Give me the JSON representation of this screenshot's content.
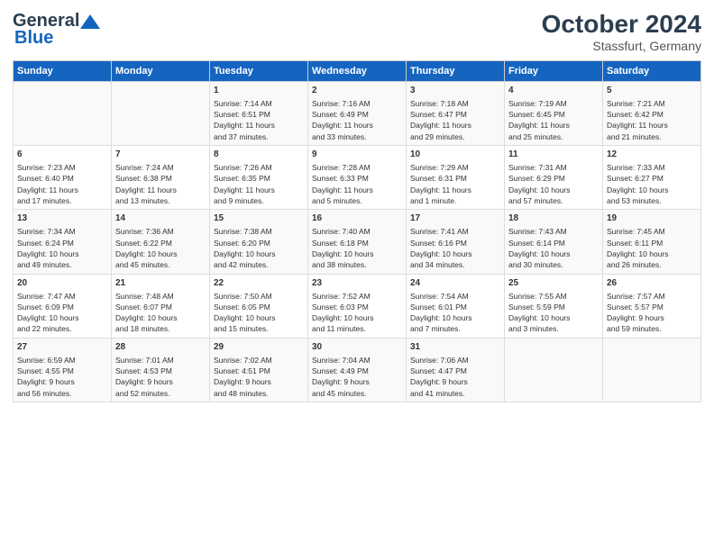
{
  "header": {
    "logo_general": "General",
    "logo_blue": "Blue",
    "title": "October 2024",
    "subtitle": "Stassfurt, Germany"
  },
  "columns": [
    "Sunday",
    "Monday",
    "Tuesday",
    "Wednesday",
    "Thursday",
    "Friday",
    "Saturday"
  ],
  "weeks": [
    [
      {
        "day": "",
        "content": ""
      },
      {
        "day": "",
        "content": ""
      },
      {
        "day": "1",
        "content": "Sunrise: 7:14 AM\nSunset: 6:51 PM\nDaylight: 11 hours\nand 37 minutes."
      },
      {
        "day": "2",
        "content": "Sunrise: 7:16 AM\nSunset: 6:49 PM\nDaylight: 11 hours\nand 33 minutes."
      },
      {
        "day": "3",
        "content": "Sunrise: 7:18 AM\nSunset: 6:47 PM\nDaylight: 11 hours\nand 29 minutes."
      },
      {
        "day": "4",
        "content": "Sunrise: 7:19 AM\nSunset: 6:45 PM\nDaylight: 11 hours\nand 25 minutes."
      },
      {
        "day": "5",
        "content": "Sunrise: 7:21 AM\nSunset: 6:42 PM\nDaylight: 11 hours\nand 21 minutes."
      }
    ],
    [
      {
        "day": "6",
        "content": "Sunrise: 7:23 AM\nSunset: 6:40 PM\nDaylight: 11 hours\nand 17 minutes."
      },
      {
        "day": "7",
        "content": "Sunrise: 7:24 AM\nSunset: 6:38 PM\nDaylight: 11 hours\nand 13 minutes."
      },
      {
        "day": "8",
        "content": "Sunrise: 7:26 AM\nSunset: 6:35 PM\nDaylight: 11 hours\nand 9 minutes."
      },
      {
        "day": "9",
        "content": "Sunrise: 7:28 AM\nSunset: 6:33 PM\nDaylight: 11 hours\nand 5 minutes."
      },
      {
        "day": "10",
        "content": "Sunrise: 7:29 AM\nSunset: 6:31 PM\nDaylight: 11 hours\nand 1 minute."
      },
      {
        "day": "11",
        "content": "Sunrise: 7:31 AM\nSunset: 6:29 PM\nDaylight: 10 hours\nand 57 minutes."
      },
      {
        "day": "12",
        "content": "Sunrise: 7:33 AM\nSunset: 6:27 PM\nDaylight: 10 hours\nand 53 minutes."
      }
    ],
    [
      {
        "day": "13",
        "content": "Sunrise: 7:34 AM\nSunset: 6:24 PM\nDaylight: 10 hours\nand 49 minutes."
      },
      {
        "day": "14",
        "content": "Sunrise: 7:36 AM\nSunset: 6:22 PM\nDaylight: 10 hours\nand 45 minutes."
      },
      {
        "day": "15",
        "content": "Sunrise: 7:38 AM\nSunset: 6:20 PM\nDaylight: 10 hours\nand 42 minutes."
      },
      {
        "day": "16",
        "content": "Sunrise: 7:40 AM\nSunset: 6:18 PM\nDaylight: 10 hours\nand 38 minutes."
      },
      {
        "day": "17",
        "content": "Sunrise: 7:41 AM\nSunset: 6:16 PM\nDaylight: 10 hours\nand 34 minutes."
      },
      {
        "day": "18",
        "content": "Sunrise: 7:43 AM\nSunset: 6:14 PM\nDaylight: 10 hours\nand 30 minutes."
      },
      {
        "day": "19",
        "content": "Sunrise: 7:45 AM\nSunset: 6:11 PM\nDaylight: 10 hours\nand 26 minutes."
      }
    ],
    [
      {
        "day": "20",
        "content": "Sunrise: 7:47 AM\nSunset: 6:09 PM\nDaylight: 10 hours\nand 22 minutes."
      },
      {
        "day": "21",
        "content": "Sunrise: 7:48 AM\nSunset: 6:07 PM\nDaylight: 10 hours\nand 18 minutes."
      },
      {
        "day": "22",
        "content": "Sunrise: 7:50 AM\nSunset: 6:05 PM\nDaylight: 10 hours\nand 15 minutes."
      },
      {
        "day": "23",
        "content": "Sunrise: 7:52 AM\nSunset: 6:03 PM\nDaylight: 10 hours\nand 11 minutes."
      },
      {
        "day": "24",
        "content": "Sunrise: 7:54 AM\nSunset: 6:01 PM\nDaylight: 10 hours\nand 7 minutes."
      },
      {
        "day": "25",
        "content": "Sunrise: 7:55 AM\nSunset: 5:59 PM\nDaylight: 10 hours\nand 3 minutes."
      },
      {
        "day": "26",
        "content": "Sunrise: 7:57 AM\nSunset: 5:57 PM\nDaylight: 9 hours\nand 59 minutes."
      }
    ],
    [
      {
        "day": "27",
        "content": "Sunrise: 6:59 AM\nSunset: 4:55 PM\nDaylight: 9 hours\nand 56 minutes."
      },
      {
        "day": "28",
        "content": "Sunrise: 7:01 AM\nSunset: 4:53 PM\nDaylight: 9 hours\nand 52 minutes."
      },
      {
        "day": "29",
        "content": "Sunrise: 7:02 AM\nSunset: 4:51 PM\nDaylight: 9 hours\nand 48 minutes."
      },
      {
        "day": "30",
        "content": "Sunrise: 7:04 AM\nSunset: 4:49 PM\nDaylight: 9 hours\nand 45 minutes."
      },
      {
        "day": "31",
        "content": "Sunrise: 7:06 AM\nSunset: 4:47 PM\nDaylight: 9 hours\nand 41 minutes."
      },
      {
        "day": "",
        "content": ""
      },
      {
        "day": "",
        "content": ""
      }
    ]
  ]
}
